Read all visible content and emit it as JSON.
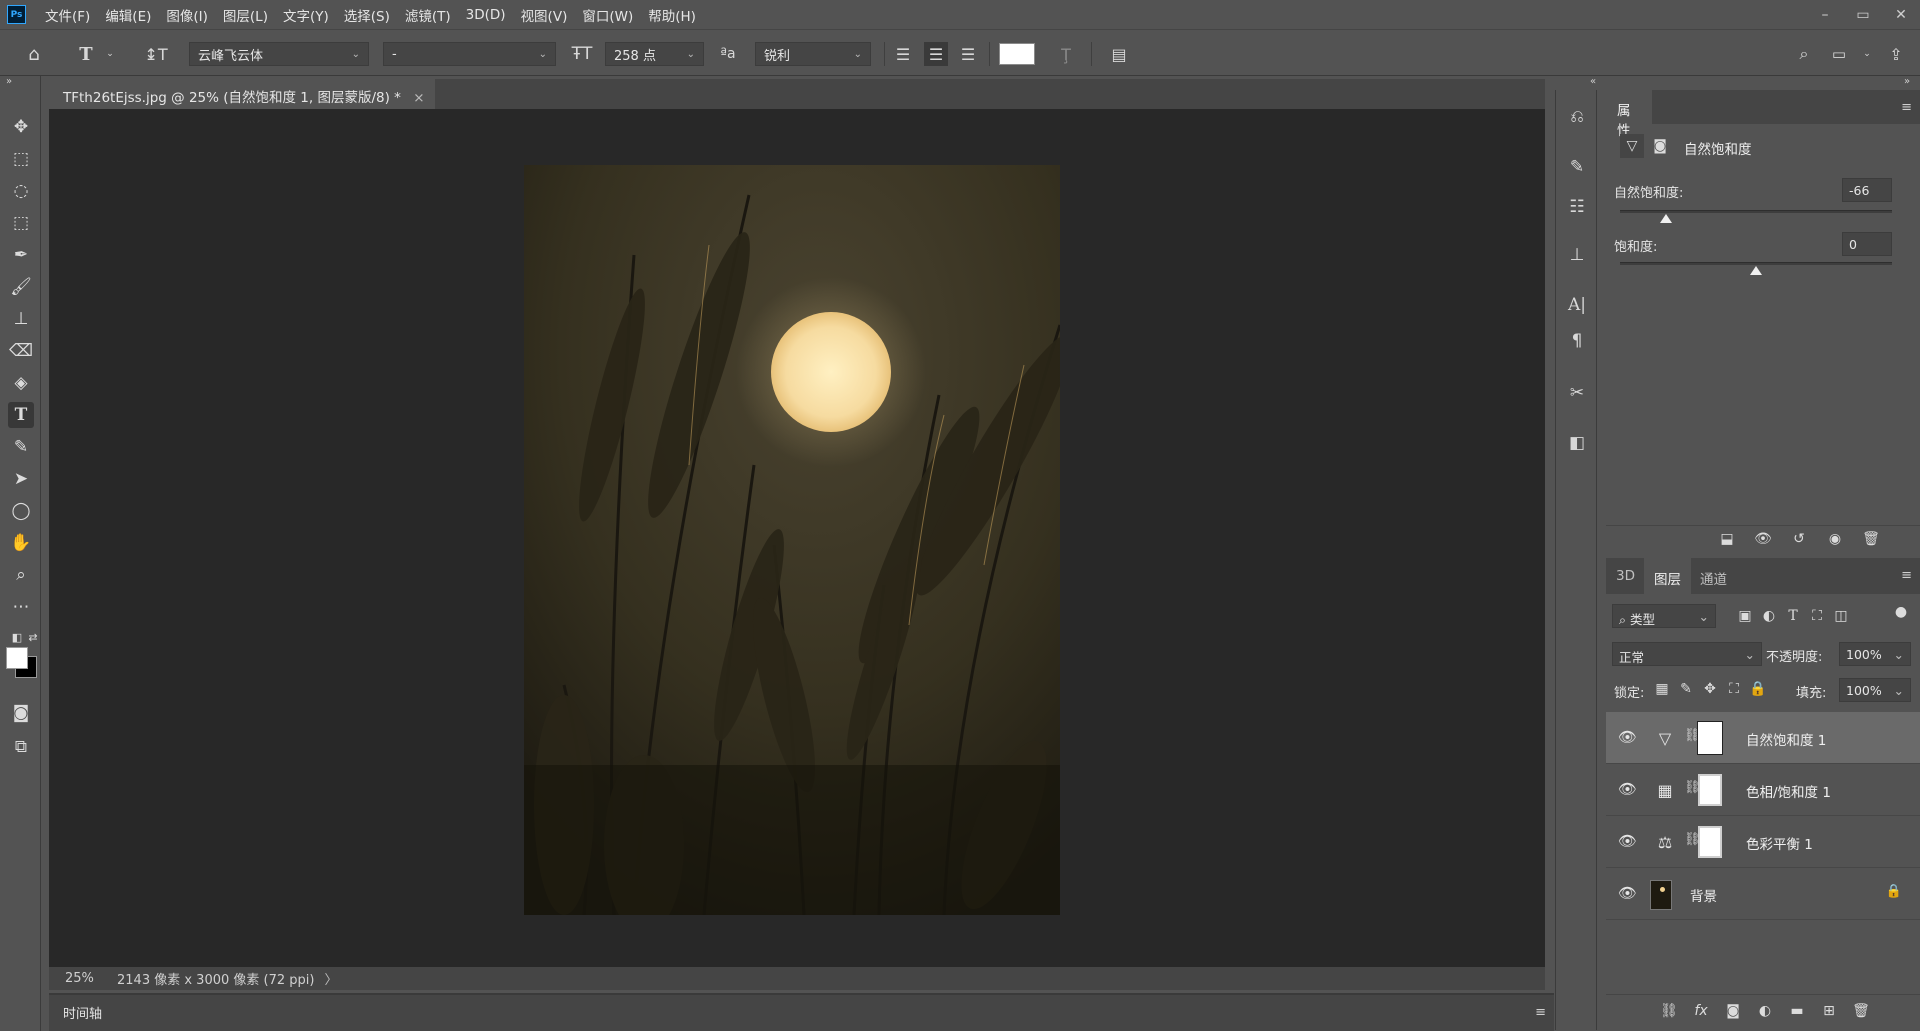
{
  "app": {
    "logo": "Ps",
    "menu": [
      "文件(F)",
      "编辑(E)",
      "图像(I)",
      "图层(L)",
      "文字(Y)",
      "选择(S)",
      "滤镜(T)",
      "3D(D)",
      "视图(V)",
      "窗口(W)",
      "帮助(H)"
    ],
    "window_controls": [
      "–",
      "▭",
      "✕"
    ]
  },
  "options_bar": {
    "font_family": "云峰飞云体",
    "font_style": "-",
    "font_size": "258 点",
    "antialias": "锐利",
    "text_color": "#ffffff"
  },
  "document": {
    "tab_title": "TFth26tEjss.jpg @ 25% (自然饱和度 1, 图层蒙版/8) *",
    "tab_close": "×",
    "zoom": "25%",
    "info": "2143 像素 x 3000 像素 (72 ppi)",
    "info_arrow": "〉"
  },
  "timeline": {
    "label": "时间轴"
  },
  "properties": {
    "tab": "属性",
    "header_title": "自然饱和度",
    "vibrance_label": "自然饱和度:",
    "vibrance_value": "-66",
    "vibrance_level": -66,
    "saturation_label": "饱和度:",
    "saturation_value": "0",
    "saturation_level": 0
  },
  "layers_panel": {
    "tabs": [
      "3D",
      "图层",
      "通道"
    ],
    "active_tab": "图层",
    "filter_label": "类型",
    "blend_mode": "正常",
    "opacity_label": "不透明度:",
    "opacity_value": "100%",
    "lock_label": "锁定:",
    "fill_label": "填充:",
    "fill_value": "100%",
    "layers": [
      {
        "name": "自然饱和度 1",
        "icon": "vibrance-triangle",
        "glyph": "▽",
        "selected": true,
        "has_mask": true
      },
      {
        "name": "色相/饱和度 1",
        "icon": "hue-saturation",
        "glyph": "▦",
        "selected": false,
        "has_mask": true
      },
      {
        "name": "色彩平衡 1",
        "icon": "color-balance",
        "glyph": "⚖",
        "selected": false,
        "has_mask": true
      },
      {
        "name": "背景",
        "icon": "image-thumbnail",
        "glyph": "",
        "selected": false,
        "has_mask": false,
        "locked": true
      }
    ]
  },
  "colors": {
    "ui_gray": "#535353",
    "ui_dark": "#454545",
    "canvas_bg": "#282828",
    "accent": "#31a8ff"
  }
}
